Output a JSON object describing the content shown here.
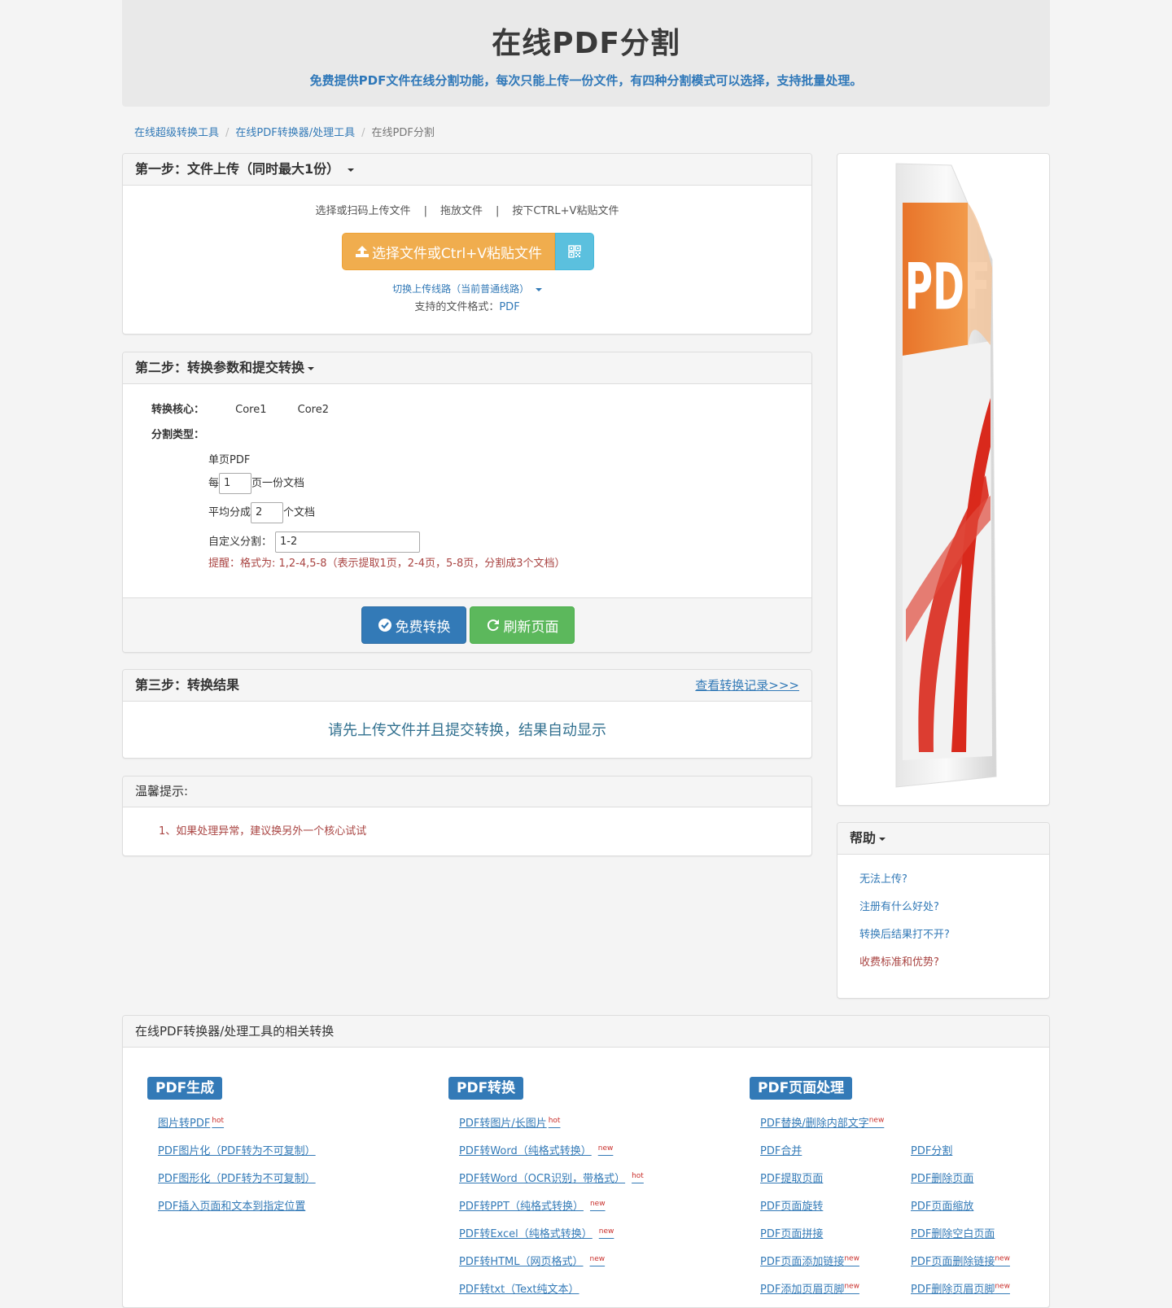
{
  "header": {
    "title": "在线PDF分割",
    "subtitle": "免费提供PDF文件在线分割功能，每次只能上传一份文件，有四种分割模式可以选择，支持批量处理。"
  },
  "breadcrumb": [
    "在线超级转换工具",
    "在线PDF转换器/处理工具",
    "在线PDF分割"
  ],
  "step1": {
    "title": "第一步：文件上传（同时最大1份）",
    "methods": [
      "选择或扫码上传文件",
      "拖放文件",
      "按下CTRL+V粘贴文件"
    ],
    "method_sep": "|",
    "upload_button": "选择文件或Ctrl+V粘贴文件",
    "switch_line": "切换上传线路（当前普通线路）",
    "formats_label": "支持的文件格式：",
    "formats_value": "PDF"
  },
  "step2": {
    "title": "第二步：转换参数和提交转换",
    "core_label": "转换核心：",
    "cores": [
      "Core1",
      "Core2"
    ],
    "split_label": "分割类型：",
    "opt_single": "单页PDF",
    "opt_every_pre": "每",
    "opt_every_value": "1",
    "opt_every_post": "页一份文档",
    "opt_avg_pre": "平均分成",
    "opt_avg_value": "2",
    "opt_avg_post": "个文档",
    "opt_custom_label": "自定义分割：",
    "opt_custom_value": "1-2",
    "hint": "提醒：格式为: 1,2-4,5-8（表示提取1页，2-4页，5-8页，分割成3个文档）",
    "convert_button": "免费转换",
    "refresh_button": "刷新页面"
  },
  "step3": {
    "title": "第三步：转换结果",
    "history_link": "查看转换记录>>>",
    "message": "请先上传文件并且提交转换，结果自动显示"
  },
  "tips": {
    "title": "温馨提示:",
    "items": [
      "1、如果处理异常，建议换另外一个核心试试"
    ]
  },
  "help": {
    "title": "帮助",
    "items": [
      "无法上传?",
      "注册有什么好处?",
      "转换后结果打不开?",
      "收费标准和优势?"
    ]
  },
  "related": {
    "title": "在线PDF转换器/处理工具的相关转换",
    "groups": [
      {
        "name": "PDF生成",
        "links": [
          "图片转PDF",
          "PDF图片化（PDF转为不可复制）",
          "PDF图形化（PDF转为不可复制）",
          "PDF插入页面和文本到指定位置"
        ]
      },
      {
        "name": "PDF转换",
        "links": [
          "PDF转图片/长图片",
          "PDF转Word（纯格式转换）",
          "PDF转Word（OCR识别，带格式）",
          "PDF转PPT（纯格式转换）",
          "PDF转Excel（纯格式转换）",
          "PDF转HTML（网页格式）",
          "PDF转txt（Text纯文本）"
        ]
      },
      {
        "name": "PDF页面处理",
        "links": [
          "PDF替换/删除内部文字",
          "PDF合并",
          "PDF分割",
          "PDF提取页面",
          "PDF删除页面",
          "PDF页面旋转",
          "PDF页面缩放",
          "PDF页面拼接",
          "PDF删除空白页面",
          "PDF页面添加链接",
          "PDF页面删除链接",
          "PDF添加页眉页脚",
          "PDF删除页眉页脚"
        ]
      }
    ],
    "badges": {
      "hot": "hot",
      "new": "new"
    }
  },
  "illustration": {
    "logo_text": "PDF"
  },
  "colors": {
    "primary": "#337ab7",
    "warning": "#f0ad4e",
    "info": "#5bc0de",
    "success": "#5cb85c",
    "danger_text": "#a94442",
    "pdf_red": "#d9291c"
  }
}
